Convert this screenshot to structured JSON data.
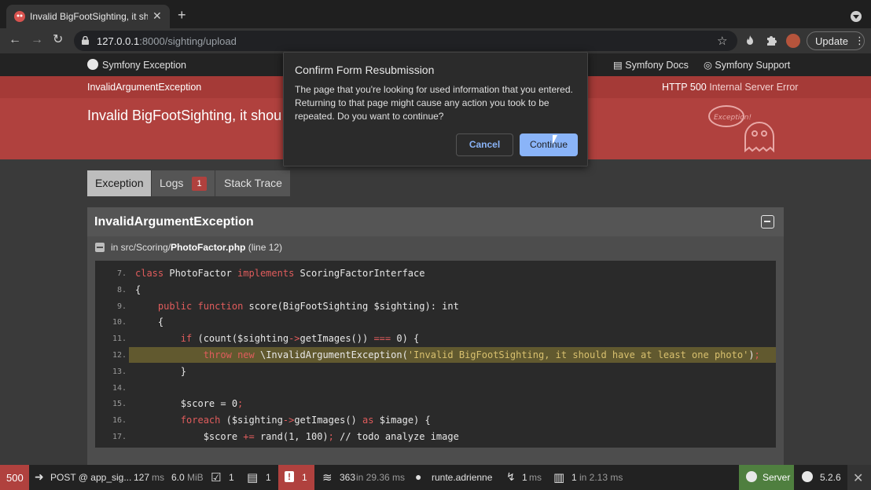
{
  "browser": {
    "tab_title": "Invalid BigFootSighting, it shou",
    "new_tab": "+",
    "url_host": "127.0.0.1",
    "url_rest": ":8000/sighting/upload",
    "update_label": "Update"
  },
  "header": {
    "brand": "Symfony Exception",
    "docs": "Symfony Docs",
    "support": "Symfony Support"
  },
  "error": {
    "class": "InvalidArgumentException",
    "http_code": "HTTP 500",
    "http_text": "Internal Server Error",
    "message": "Invalid BigFootSighting, it shou",
    "ghost_label": "Exception!"
  },
  "tabs": [
    {
      "label": "Exception"
    },
    {
      "label": "Logs",
      "badge": "1"
    },
    {
      "label": "Stack Trace"
    }
  ],
  "exception": {
    "title": "InvalidArgumentException",
    "file_prefix": "in src/Scoring/",
    "file_name": "PhotoFactor.php",
    "file_line": "(line 12)"
  },
  "code_lines": [
    {
      "n": "7.",
      "t": "class PhotoFactor implements ScoringFactorInterface"
    },
    {
      "n": "8.",
      "t": "{"
    },
    {
      "n": "9.",
      "t": "    public function score(BigFootSighting $sighting): int"
    },
    {
      "n": "10.",
      "t": "    {"
    },
    {
      "n": "11.",
      "t": "        if (count($sighting->getImages()) === 0) {"
    },
    {
      "n": "12.",
      "t": "            throw new \\InvalidArgumentException('Invalid BigFootSighting, it should have at least one photo');"
    },
    {
      "n": "13.",
      "t": "        }"
    },
    {
      "n": "14.",
      "t": ""
    },
    {
      "n": "15.",
      "t": "        $score = 0;"
    },
    {
      "n": "16.",
      "t": "        foreach ($sighting->getImages() as $image) {"
    },
    {
      "n": "17.",
      "t": "            $score += rand(1, 100); // todo analyze image"
    }
  ],
  "dialog": {
    "title": "Confirm Form Resubmission",
    "body": "The page that you're looking for used information that you entered. Returning to that page might cause any action you took to be repeated. Do you want to continue?",
    "cancel": "Cancel",
    "continue": "Continue"
  },
  "toolbar": {
    "status": "500",
    "request": "POST @ app_sig...",
    "time": "127",
    "time_unit": "ms",
    "memory": "6.0",
    "memory_unit": "MiB",
    "validator": "1",
    "forms": "1",
    "logs": "1",
    "queries": "363",
    "queries_time": "in 29.36 ms",
    "user": "runte.adrienne",
    "events": "1",
    "events_unit": "ms",
    "cache": "1",
    "cache_time": "in 2.13 ms",
    "server": "Server",
    "version": "5.2.6"
  },
  "colors": {
    "error_red": "#b0413e",
    "link_blue": "#8ab4f8",
    "highlight": "#61592f",
    "server_green": "#4f7f3f"
  }
}
